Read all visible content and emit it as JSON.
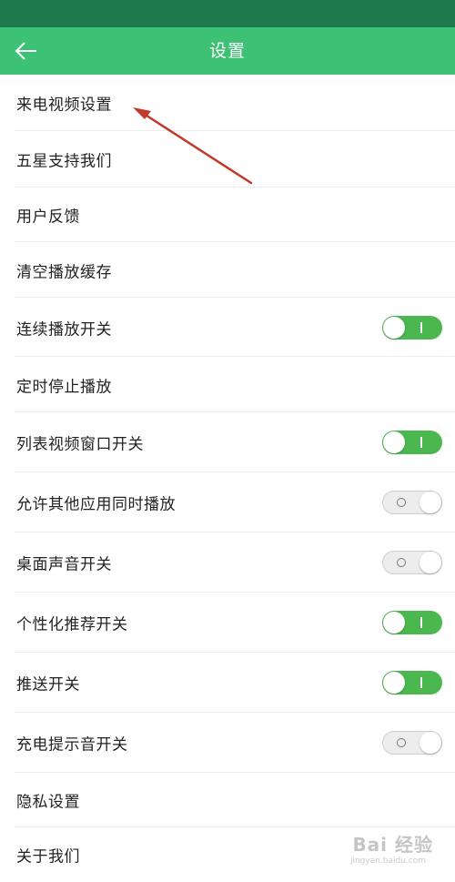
{
  "header": {
    "title": "设置",
    "back_icon": "arrow-left-icon"
  },
  "colors": {
    "status_bar": "#1e7a4c",
    "app_bar": "#3dc174",
    "toggle_on": "#4bb84f",
    "toggle_off": "#ededed",
    "annotation_arrow": "#c0392b"
  },
  "settings": [
    {
      "label": "来电视频设置",
      "toggle": null
    },
    {
      "label": "五星支持我们",
      "toggle": null
    },
    {
      "label": "用户反馈",
      "toggle": null
    },
    {
      "label": "清空播放缓存",
      "toggle": null
    },
    {
      "label": "连续播放开关",
      "toggle": "on"
    },
    {
      "label": "定时停止播放",
      "toggle": null
    },
    {
      "label": "列表视频窗口开关",
      "toggle": "on"
    },
    {
      "label": "允许其他应用同时播放",
      "toggle": "off"
    },
    {
      "label": "桌面声音开关",
      "toggle": "off"
    },
    {
      "label": "个性化推荐开关",
      "toggle": "on"
    },
    {
      "label": "推送开关",
      "toggle": "on"
    },
    {
      "label": "充电提示音开关",
      "toggle": "off"
    },
    {
      "label": "隐私设置",
      "toggle": null
    },
    {
      "label": "关于我们",
      "toggle": null
    }
  ],
  "watermark": {
    "text": "Bai 经验",
    "sub": "jingyan.baidu.com"
  }
}
